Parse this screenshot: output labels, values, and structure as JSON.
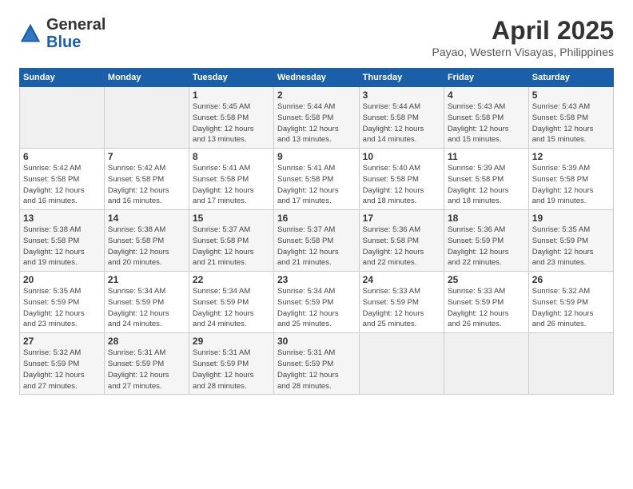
{
  "header": {
    "logo_general": "General",
    "logo_blue": "Blue",
    "month_year": "April 2025",
    "location": "Payao, Western Visayas, Philippines"
  },
  "weekdays": [
    "Sunday",
    "Monday",
    "Tuesday",
    "Wednesday",
    "Thursday",
    "Friday",
    "Saturday"
  ],
  "weeks": [
    [
      {
        "day": "",
        "info": ""
      },
      {
        "day": "",
        "info": ""
      },
      {
        "day": "1",
        "info": "Sunrise: 5:45 AM\nSunset: 5:58 PM\nDaylight: 12 hours\nand 13 minutes."
      },
      {
        "day": "2",
        "info": "Sunrise: 5:44 AM\nSunset: 5:58 PM\nDaylight: 12 hours\nand 13 minutes."
      },
      {
        "day": "3",
        "info": "Sunrise: 5:44 AM\nSunset: 5:58 PM\nDaylight: 12 hours\nand 14 minutes."
      },
      {
        "day": "4",
        "info": "Sunrise: 5:43 AM\nSunset: 5:58 PM\nDaylight: 12 hours\nand 15 minutes."
      },
      {
        "day": "5",
        "info": "Sunrise: 5:43 AM\nSunset: 5:58 PM\nDaylight: 12 hours\nand 15 minutes."
      }
    ],
    [
      {
        "day": "6",
        "info": "Sunrise: 5:42 AM\nSunset: 5:58 PM\nDaylight: 12 hours\nand 16 minutes."
      },
      {
        "day": "7",
        "info": "Sunrise: 5:42 AM\nSunset: 5:58 PM\nDaylight: 12 hours\nand 16 minutes."
      },
      {
        "day": "8",
        "info": "Sunrise: 5:41 AM\nSunset: 5:58 PM\nDaylight: 12 hours\nand 17 minutes."
      },
      {
        "day": "9",
        "info": "Sunrise: 5:41 AM\nSunset: 5:58 PM\nDaylight: 12 hours\nand 17 minutes."
      },
      {
        "day": "10",
        "info": "Sunrise: 5:40 AM\nSunset: 5:58 PM\nDaylight: 12 hours\nand 18 minutes."
      },
      {
        "day": "11",
        "info": "Sunrise: 5:39 AM\nSunset: 5:58 PM\nDaylight: 12 hours\nand 18 minutes."
      },
      {
        "day": "12",
        "info": "Sunrise: 5:39 AM\nSunset: 5:58 PM\nDaylight: 12 hours\nand 19 minutes."
      }
    ],
    [
      {
        "day": "13",
        "info": "Sunrise: 5:38 AM\nSunset: 5:58 PM\nDaylight: 12 hours\nand 19 minutes."
      },
      {
        "day": "14",
        "info": "Sunrise: 5:38 AM\nSunset: 5:58 PM\nDaylight: 12 hours\nand 20 minutes."
      },
      {
        "day": "15",
        "info": "Sunrise: 5:37 AM\nSunset: 5:58 PM\nDaylight: 12 hours\nand 21 minutes."
      },
      {
        "day": "16",
        "info": "Sunrise: 5:37 AM\nSunset: 5:58 PM\nDaylight: 12 hours\nand 21 minutes."
      },
      {
        "day": "17",
        "info": "Sunrise: 5:36 AM\nSunset: 5:58 PM\nDaylight: 12 hours\nand 22 minutes."
      },
      {
        "day": "18",
        "info": "Sunrise: 5:36 AM\nSunset: 5:59 PM\nDaylight: 12 hours\nand 22 minutes."
      },
      {
        "day": "19",
        "info": "Sunrise: 5:35 AM\nSunset: 5:59 PM\nDaylight: 12 hours\nand 23 minutes."
      }
    ],
    [
      {
        "day": "20",
        "info": "Sunrise: 5:35 AM\nSunset: 5:59 PM\nDaylight: 12 hours\nand 23 minutes."
      },
      {
        "day": "21",
        "info": "Sunrise: 5:34 AM\nSunset: 5:59 PM\nDaylight: 12 hours\nand 24 minutes."
      },
      {
        "day": "22",
        "info": "Sunrise: 5:34 AM\nSunset: 5:59 PM\nDaylight: 12 hours\nand 24 minutes."
      },
      {
        "day": "23",
        "info": "Sunrise: 5:34 AM\nSunset: 5:59 PM\nDaylight: 12 hours\nand 25 minutes."
      },
      {
        "day": "24",
        "info": "Sunrise: 5:33 AM\nSunset: 5:59 PM\nDaylight: 12 hours\nand 25 minutes."
      },
      {
        "day": "25",
        "info": "Sunrise: 5:33 AM\nSunset: 5:59 PM\nDaylight: 12 hours\nand 26 minutes."
      },
      {
        "day": "26",
        "info": "Sunrise: 5:32 AM\nSunset: 5:59 PM\nDaylight: 12 hours\nand 26 minutes."
      }
    ],
    [
      {
        "day": "27",
        "info": "Sunrise: 5:32 AM\nSunset: 5:59 PM\nDaylight: 12 hours\nand 27 minutes."
      },
      {
        "day": "28",
        "info": "Sunrise: 5:31 AM\nSunset: 5:59 PM\nDaylight: 12 hours\nand 27 minutes."
      },
      {
        "day": "29",
        "info": "Sunrise: 5:31 AM\nSunset: 5:59 PM\nDaylight: 12 hours\nand 28 minutes."
      },
      {
        "day": "30",
        "info": "Sunrise: 5:31 AM\nSunset: 5:59 PM\nDaylight: 12 hours\nand 28 minutes."
      },
      {
        "day": "",
        "info": ""
      },
      {
        "day": "",
        "info": ""
      },
      {
        "day": "",
        "info": ""
      }
    ]
  ]
}
